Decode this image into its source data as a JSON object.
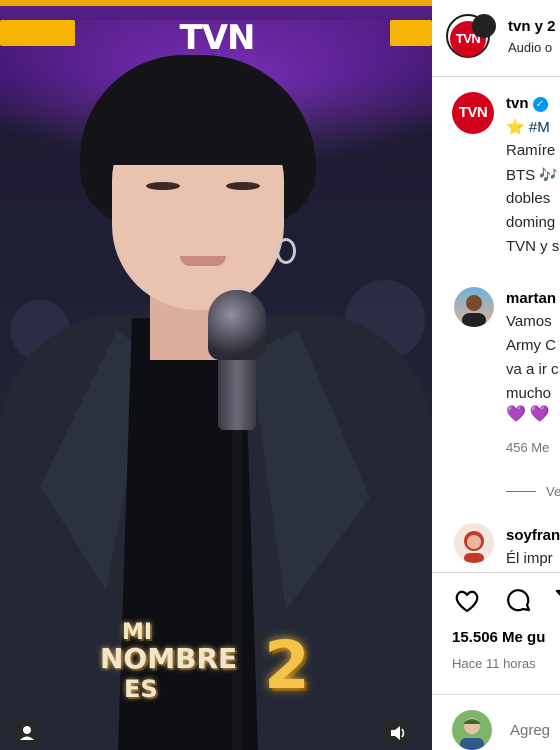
{
  "video": {
    "channel_logo": "TVN",
    "show_logo": {
      "line1": "MI",
      "line2": "NOMBRE",
      "line3": "ES",
      "season": "2"
    },
    "controls": {
      "user_icon": "user-icon",
      "audio_icon": "speaker-icon"
    }
  },
  "header": {
    "account_name": "tvn y 2",
    "subtitle": "Audio o",
    "avatar_text": "TVN"
  },
  "caption": {
    "account_name": "tvn",
    "avatar_text": "TVN",
    "lines": [
      "#M",
      "Ramíre",
      "BTS",
      "dobles",
      "doming",
      "TVN y s"
    ],
    "star_emoji": "⭐",
    "music_emoji": "🎶"
  },
  "comments": [
    {
      "username": "martan",
      "lines": [
        "Vamos",
        "Army C",
        "va a ir c",
        "mucho"
      ],
      "hearts": "💜💜",
      "likes": "456 Me",
      "view_replies": "Ve"
    },
    {
      "username": "soyfran",
      "lines": [
        "Él impr"
      ]
    }
  ],
  "actions": {
    "like_icon": "heart-icon",
    "comment_icon": "comment-icon",
    "share_icon": "share-icon"
  },
  "likes_count": "15.506 Me gu",
  "timestamp": "Hace 11 horas",
  "add_comment_placeholder": "Agreg",
  "colors": {
    "tvn_red": "#d4001c",
    "verified_blue": "#0095f6",
    "hashtag_blue": "#00376b",
    "accent_gold": "#f6b400"
  }
}
